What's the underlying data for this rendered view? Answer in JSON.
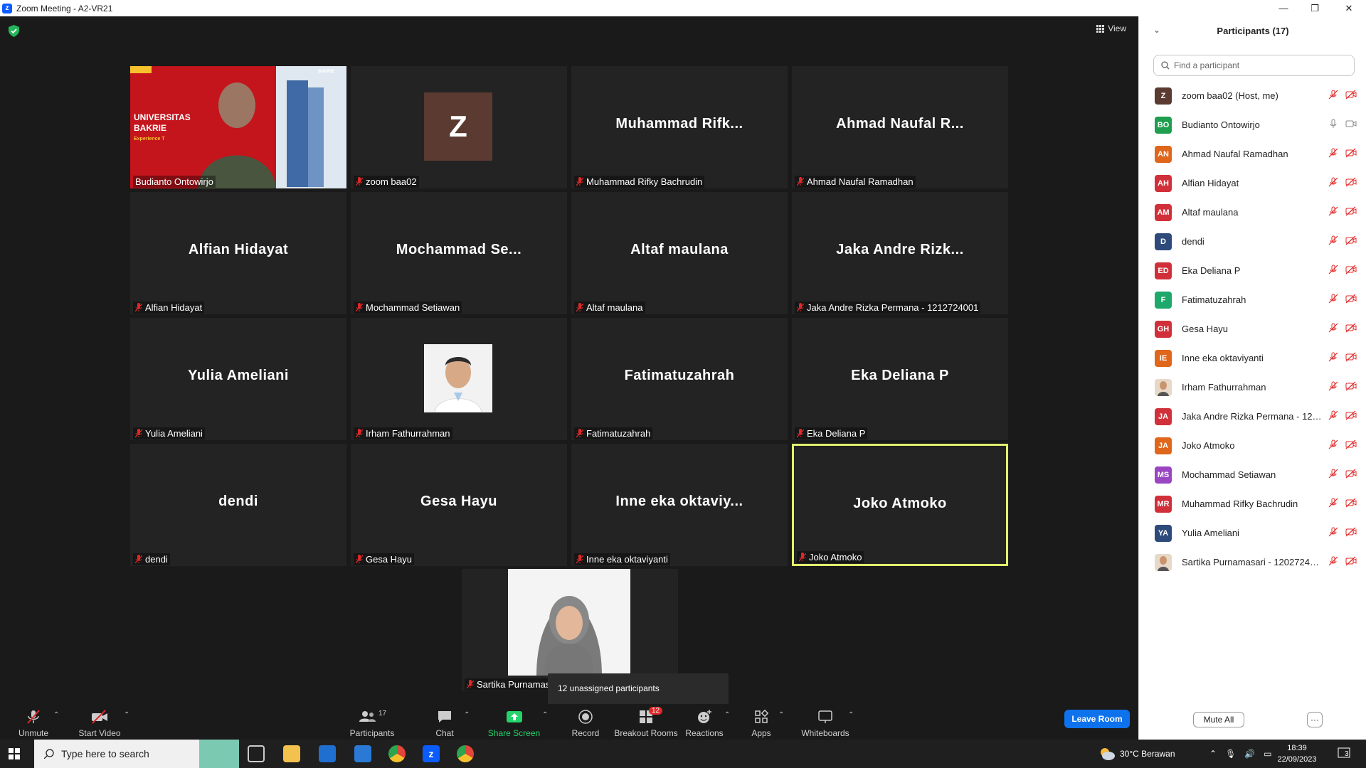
{
  "window": {
    "title": "Zoom Meeting - A2-VR21"
  },
  "view_label": "View",
  "tiles": [
    {
      "big": "",
      "label": "Budianto Ontowirjo",
      "muted": false,
      "video": "slide"
    },
    {
      "big": "Z",
      "label": "zoom baa02",
      "muted": true,
      "video": "avatar"
    },
    {
      "big": "Muhammad  Rifk...",
      "label": "Muhammad Rifky Bachrudin",
      "muted": true,
      "video": "none"
    },
    {
      "big": "Ahmad  Naufal  R...",
      "label": "Ahmad Naufal Ramadhan",
      "muted": true,
      "video": "none"
    },
    {
      "big": "Alfian Hidayat",
      "label": "Alfian Hidayat",
      "muted": true,
      "video": "none"
    },
    {
      "big": "Mochammad  Se...",
      "label": "Mochammad Setiawan",
      "muted": true,
      "video": "none"
    },
    {
      "big": "Altaf maulana",
      "label": "Altaf maulana",
      "muted": true,
      "video": "none"
    },
    {
      "big": "Jaka Andre Rizk...",
      "label": "Jaka Andre Rizka Permana - 1212724001",
      "muted": true,
      "video": "none"
    },
    {
      "big": "Yulia Ameliani",
      "label": "Yulia Ameliani",
      "muted": true,
      "video": "none"
    },
    {
      "big": "",
      "label": "Irham Fathurrahman",
      "muted": true,
      "video": "photo"
    },
    {
      "big": "Fatimatuzahrah",
      "label": "Fatimatuzahrah",
      "muted": true,
      "video": "none"
    },
    {
      "big": "Eka Deliana P",
      "label": "Eka Deliana P",
      "muted": true,
      "video": "none"
    },
    {
      "big": "dendi",
      "label": "dendi",
      "muted": true,
      "video": "none"
    },
    {
      "big": "Gesa Hayu",
      "label": "Gesa Hayu",
      "muted": true,
      "video": "none"
    },
    {
      "big": "Inne  eka  oktaviy...",
      "label": "Inne eka oktaviyanti",
      "muted": true,
      "video": "none"
    },
    {
      "big": "Joko Atmoko",
      "label": "Joko Atmoko",
      "muted": true,
      "video": "none"
    }
  ],
  "last_tile": {
    "label": "Sartika Purnamas"
  },
  "slide_text": {
    "line1": "UNIVERSITAS",
    "line2": "BAKRIE",
    "line3": "Experience T",
    "logo": "BAKRIE"
  },
  "tooltip": "12 unassigned participants",
  "toolbar": {
    "unmute": "Unmute",
    "start_video": "Start Video",
    "participants": "Participants",
    "participants_count": "17",
    "chat": "Chat",
    "share_screen": "Share Screen",
    "record": "Record",
    "breakout_rooms": "Breakout Rooms",
    "breakout_badge": "12",
    "reactions": "Reactions",
    "apps": "Apps",
    "whiteboards": "Whiteboards",
    "leave": "Leave Room"
  },
  "panel": {
    "title": "Participants (17)",
    "search_placeholder": "Find a participant",
    "mute_all": "Mute All",
    "more": "···",
    "participants": [
      {
        "initials": "Z",
        "name": "zoom baa02 (Host, me)",
        "color": "#5a3a31",
        "mic": "muted"
      },
      {
        "initials": "BO",
        "name": "Budianto Ontowirjo",
        "color": "#1e9e4e",
        "mic": "on"
      },
      {
        "initials": "AN",
        "name": "Ahmad Naufal Ramadhan",
        "color": "#e0661b",
        "mic": "muted"
      },
      {
        "initials": "AH",
        "name": "Alfian Hidayat",
        "color": "#d1303a",
        "mic": "muted"
      },
      {
        "initials": "AM",
        "name": "Altaf maulana",
        "color": "#d1303a",
        "mic": "muted"
      },
      {
        "initials": "D",
        "name": "dendi",
        "color": "#2e4a7a",
        "mic": "muted"
      },
      {
        "initials": "ED",
        "name": "Eka Deliana P",
        "color": "#d1303a",
        "mic": "muted"
      },
      {
        "initials": "F",
        "name": "Fatimatuzahrah",
        "color": "#1ea86b",
        "mic": "muted"
      },
      {
        "initials": "GH",
        "name": "Gesa Hayu",
        "color": "#d1303a",
        "mic": "muted"
      },
      {
        "initials": "IE",
        "name": "Inne eka oktaviyanti",
        "color": "#e0661b",
        "mic": "muted"
      },
      {
        "initials": "",
        "name": "Irham Fathurrahman",
        "color": "#e8d8c8",
        "mic": "muted"
      },
      {
        "initials": "JA",
        "name": "Jaka Andre Rizka Permana - 121...",
        "color": "#d1303a",
        "mic": "muted"
      },
      {
        "initials": "JA",
        "name": "Joko Atmoko",
        "color": "#e0661b",
        "mic": "muted"
      },
      {
        "initials": "MS",
        "name": "Mochammad Setiawan",
        "color": "#9a45c2",
        "mic": "muted"
      },
      {
        "initials": "MR",
        "name": "Muhammad Rifky Bachrudin",
        "color": "#d1303a",
        "mic": "muted"
      },
      {
        "initials": "YA",
        "name": "Yulia Ameliani",
        "color": "#2e4a7a",
        "mic": "muted"
      },
      {
        "initials": "",
        "name": "Sartika Purnamasari - 1202724001",
        "color": "#e8d8c8",
        "mic": "muted"
      }
    ]
  },
  "taskbar": {
    "search_placeholder": "Type here to search",
    "weather": "30°C  Berawan",
    "time": "18:39",
    "date": "22/09/2023",
    "notif": "3"
  }
}
